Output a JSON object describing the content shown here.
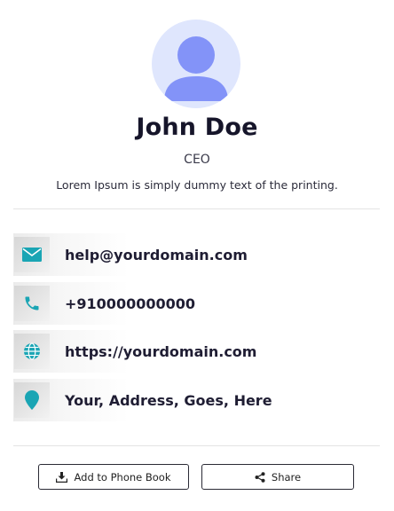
{
  "profile": {
    "name": "John Doe",
    "title": "CEO",
    "description": "Lorem Ipsum is simply dummy text of the printing."
  },
  "contacts": [
    {
      "icon": "email-icon",
      "value": "help@yourdomain.com"
    },
    {
      "icon": "phone-icon",
      "value": "+910000000000"
    },
    {
      "icon": "globe-icon",
      "value": "https://yourdomain.com"
    },
    {
      "icon": "location-pin-icon",
      "value": "Your, Address, Goes, Here"
    }
  ],
  "actions": {
    "add_to_phone_book": "Add to Phone Book",
    "share": "Share"
  },
  "colors": {
    "accent": "#1aa5b4",
    "avatar_bg": "#dfe6fd",
    "avatar_figure": "#8393f8"
  }
}
